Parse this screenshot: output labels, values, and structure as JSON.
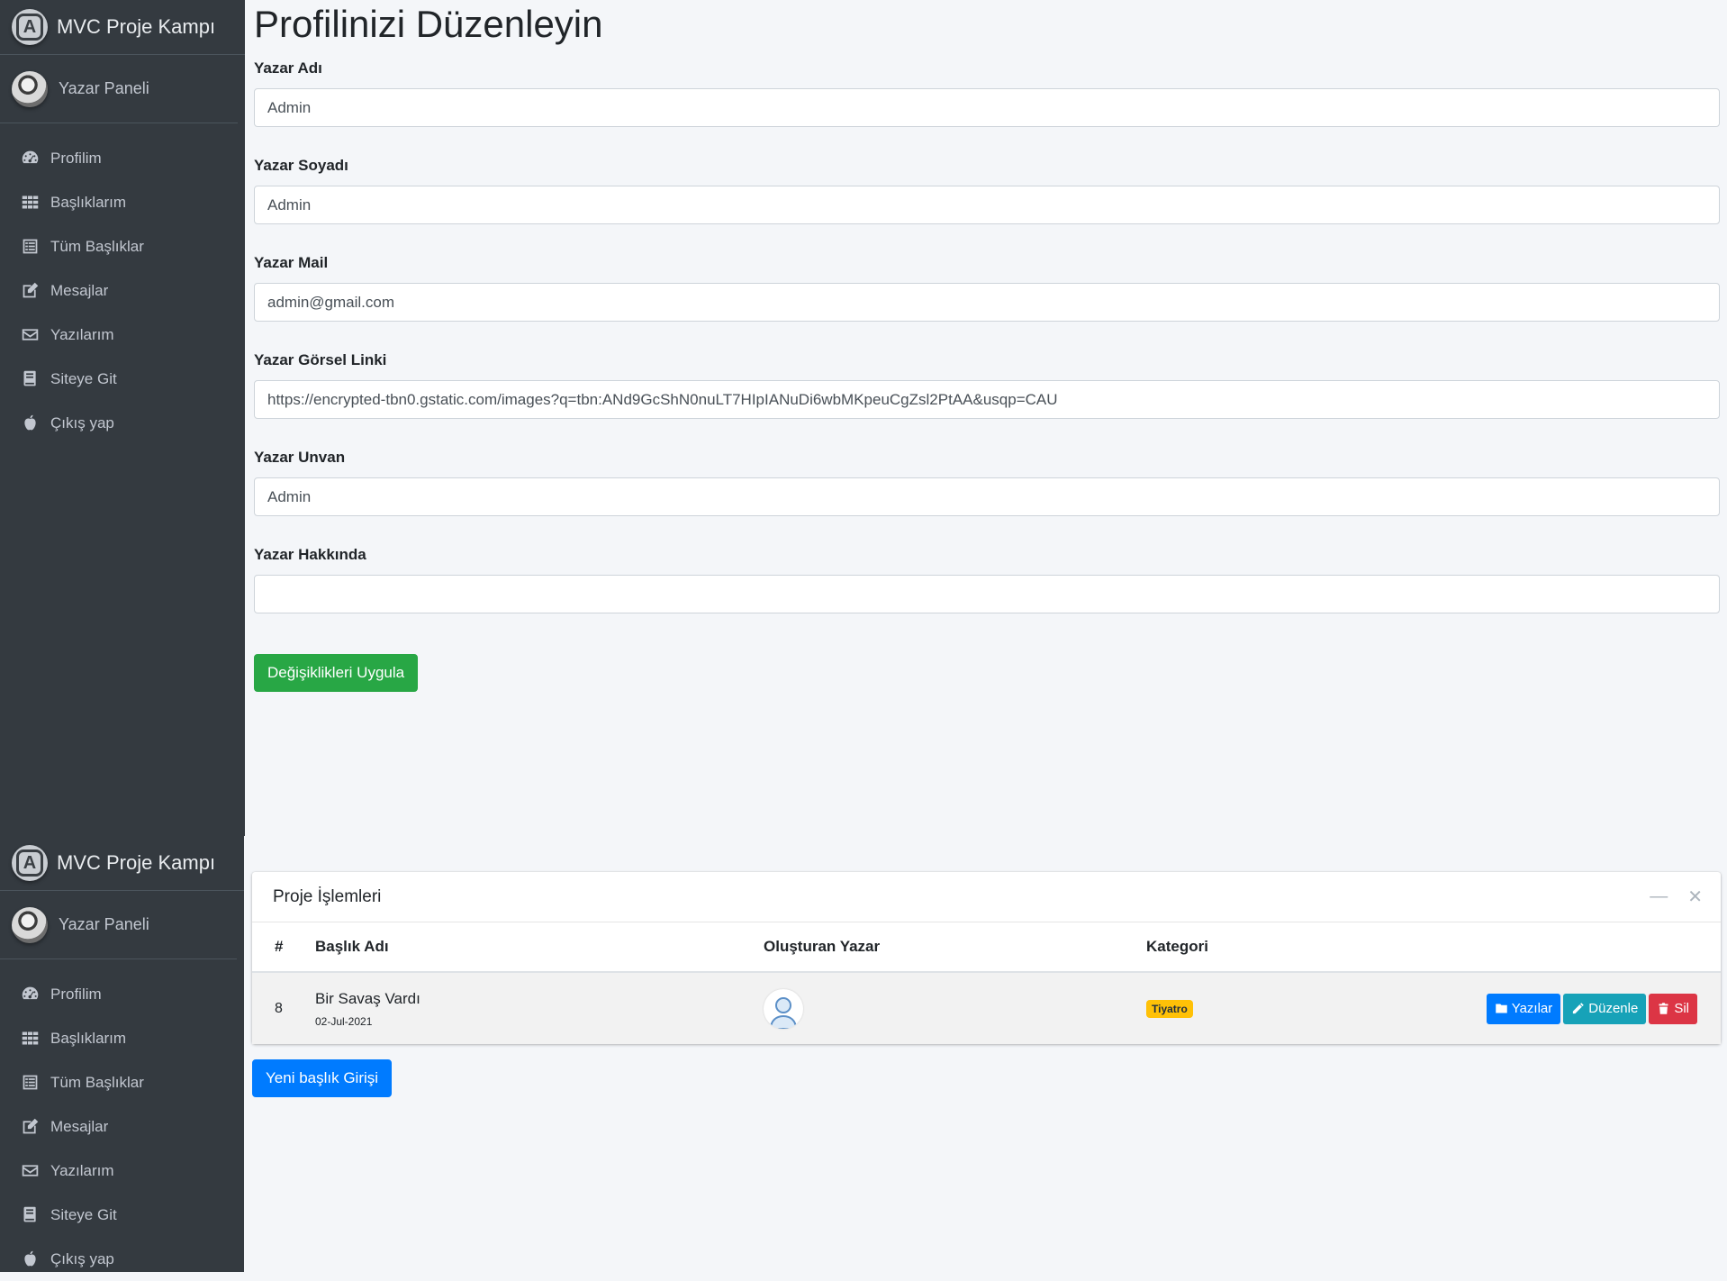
{
  "brand": {
    "title": "MVC Proje Kampı"
  },
  "user_panel": {
    "name": "Yazar Paneli"
  },
  "sidebar": {
    "items": [
      {
        "label": "Profilim",
        "icon": "dashboard-icon"
      },
      {
        "label": "Başlıklarım",
        "icon": "grid-icon"
      },
      {
        "label": "Tüm Başlıklar",
        "icon": "list-icon"
      },
      {
        "label": "Mesajlar",
        "icon": "edit-icon"
      },
      {
        "label": "Yazılarım",
        "icon": "envelope-icon"
      },
      {
        "label": "Siteye Git",
        "icon": "book-icon"
      },
      {
        "label": "Çıkış yap",
        "icon": "apple-icon"
      }
    ]
  },
  "profile_form": {
    "title": "Profilinizi Düzenleyin",
    "fields": [
      {
        "label": "Yazar Adı",
        "value": "Admin"
      },
      {
        "label": "Yazar Soyadı",
        "value": "Admin"
      },
      {
        "label": "Yazar Mail",
        "value": "admin@gmail.com"
      },
      {
        "label": "Yazar Görsel Linki",
        "value": "https://encrypted-tbn0.gstatic.com/images?q=tbn:ANd9GcShN0nuLT7HIpIANuDi6wbMKpeuCgZsl2PtAA&usqp=CAU"
      },
      {
        "label": "Yazar Unvan",
        "value": "Admin"
      },
      {
        "label": "Yazar Hakkında",
        "value": ""
      }
    ],
    "submit_label": "Değişiklikleri Uygula"
  },
  "projects_card": {
    "title": "Proje İşlemleri",
    "columns": [
      "#",
      "Başlık Adı",
      "Oluşturan Yazar",
      "Kategori"
    ],
    "rows": [
      {
        "id": "8",
        "title": "Bir Savaş Vardı",
        "date": "02-Jul-2021",
        "category": "Tiyatro",
        "actions": {
          "posts": "Yazılar",
          "edit": "Düzenle",
          "delete": "Sil"
        }
      }
    ],
    "new_button": "Yeni başlık Girişi"
  },
  "colors": {
    "sidebar_bg": "#343a40",
    "content_bg": "#f4f6f9",
    "success": "#28a745",
    "primary": "#007bff",
    "info": "#17a2b8",
    "danger": "#dc3545",
    "warning": "#ffc107"
  }
}
